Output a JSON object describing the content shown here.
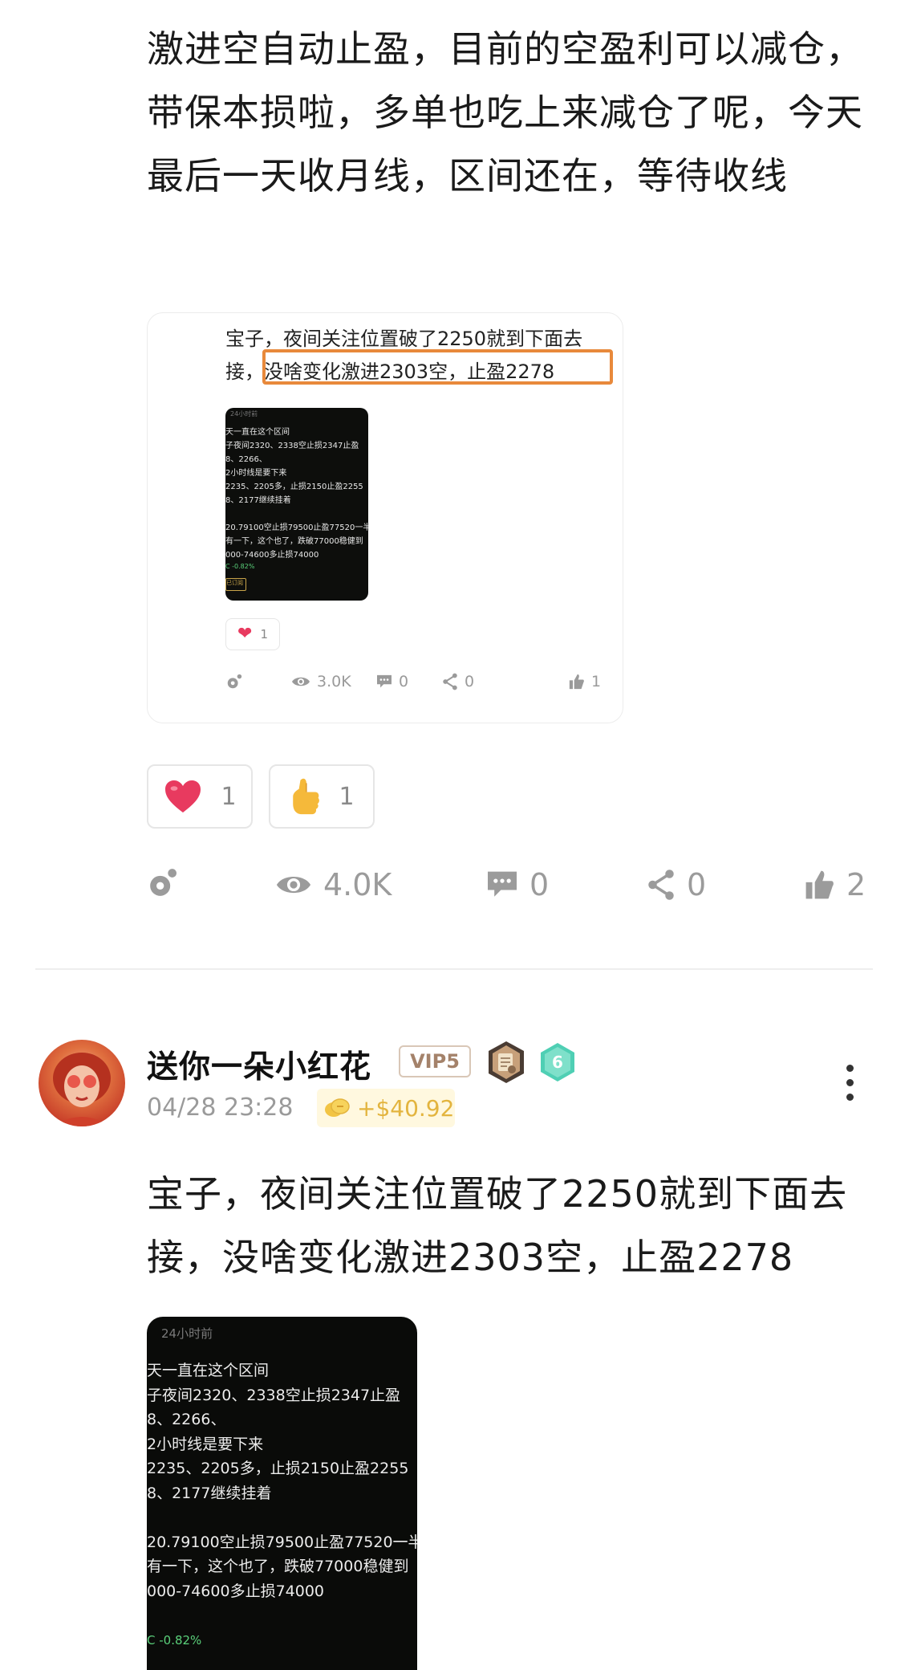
{
  "post1": {
    "text": "激进空自动止盈，目前的空盈利可以减仓，带保本损啦，多单也吃上来减仓了呢，今天最后一天收月线，区间还在，等待收线",
    "quote": {
      "text": "宝子，夜间关注位置破了2250就到下面去接，没啥变化激进2303空，止盈2278",
      "image": {
        "header": "24小时前",
        "lines": "天一直在这个区间\n子夜间2320、2338空止损2347止盈\n8、2266、\n2小时线是要下来\n2235、2205多，止损2150止盈2255\n8、2177继续挂着\n\n20.79100空止损79500止盈77520一半，\n有一下，这个也了，跌破77000稳健到\n000-74600多止损74000",
        "badge": "C -0.82%",
        "button": "已订阅"
      },
      "reaction_count": "1",
      "stats": {
        "views": "3.0K",
        "comments": "0",
        "shares": "0",
        "likes": "1"
      }
    },
    "reactions": {
      "heart_count": "1",
      "thumbs_count": "1"
    },
    "stats": {
      "views": "4.0K",
      "comments": "0",
      "shares": "0",
      "likes": "2"
    }
  },
  "post2": {
    "username": "送你一朵小红花",
    "vip": "VIP5",
    "level": "6",
    "timestamp": "04/28 23:28",
    "reward": "+$40.92",
    "text": "宝子，夜间关注位置破了2250就到下面去接，没啥变化激进2303空，止盈2278",
    "image": {
      "header": "24小时前",
      "lines": "天一直在这个区间\n子夜间2320、2338空止损2347止盈\n8、2266、\n2小时线是要下来\n2235、2205多，止损2150止盈2255\n8、2177继续挂着\n\n20.79100空止损79500止盈77520一半，\n有一下，这个也了，跌破77000稳健到\n000-74600多止损74000",
      "badge": "C -0.82%"
    }
  },
  "colors": {
    "heart": "#e83a5f",
    "highlight": "#e8893b",
    "reward": "#e3b43e",
    "level_badge": "#4fcfb4"
  }
}
